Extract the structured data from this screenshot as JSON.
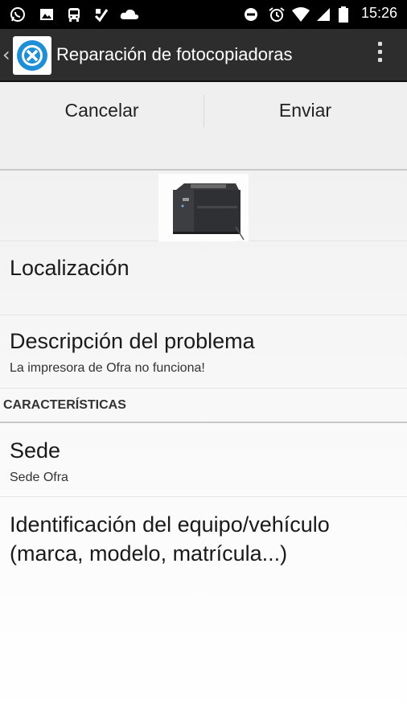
{
  "status_bar": {
    "time": "15:26",
    "left_icons": [
      "whatsapp-icon",
      "image-icon",
      "bus-icon",
      "app-icon",
      "cloud-icon"
    ],
    "right_icons": [
      "do-not-disturb-icon",
      "alarm-icon",
      "wifi-icon",
      "signal-icon",
      "battery-icon"
    ]
  },
  "action_bar": {
    "title": "Reparación de fotocopiadoras"
  },
  "buttons": {
    "cancel": "Cancelar",
    "send": "Enviar"
  },
  "form": {
    "location": {
      "title": "Localización",
      "value": ""
    },
    "description": {
      "title": "Descripción del problema",
      "value": "La impresora de Ofra no funciona!"
    },
    "section_header": "CARACTERÍSTICAS",
    "site": {
      "title": "Sede",
      "value": "Sede Ofra"
    },
    "equipment_id": {
      "title": "Identificación del equipo/vehículo\n(marca, modelo, matrícula...)",
      "value": ""
    }
  },
  "colors": {
    "status_bar": "#000000",
    "action_bar": "#2d2d2d",
    "app_icon_accent": "#1e8fd6",
    "button_bar": "#efefef"
  }
}
